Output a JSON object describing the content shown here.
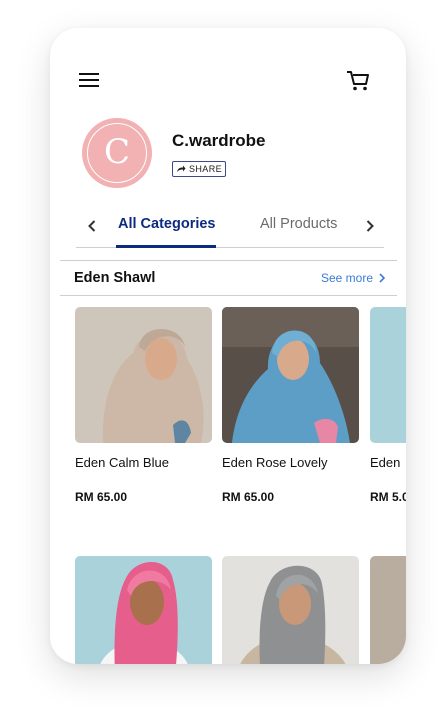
{
  "header": {
    "menu_icon": "hamburger-menu-icon",
    "cart_icon": "shopping-cart-icon"
  },
  "store": {
    "name": "C.wardrobe",
    "logo_letter": "C",
    "share_label": "SHARE",
    "logo_color": "#f2b1b2"
  },
  "tabs": {
    "items": [
      "All Categories",
      "All Products"
    ],
    "active_color": "#0e2a80"
  },
  "section": {
    "title": "Eden Shawl",
    "see_more_label": "See more"
  },
  "products": [
    {
      "name": "Eden Calm Blue",
      "price": "RM 65.00"
    },
    {
      "name": "Eden Rose Lovely",
      "price": "RM 65.00"
    },
    {
      "name": "Eden",
      "price": "RM 5.0"
    }
  ],
  "accent_color": "#3a7bd5"
}
